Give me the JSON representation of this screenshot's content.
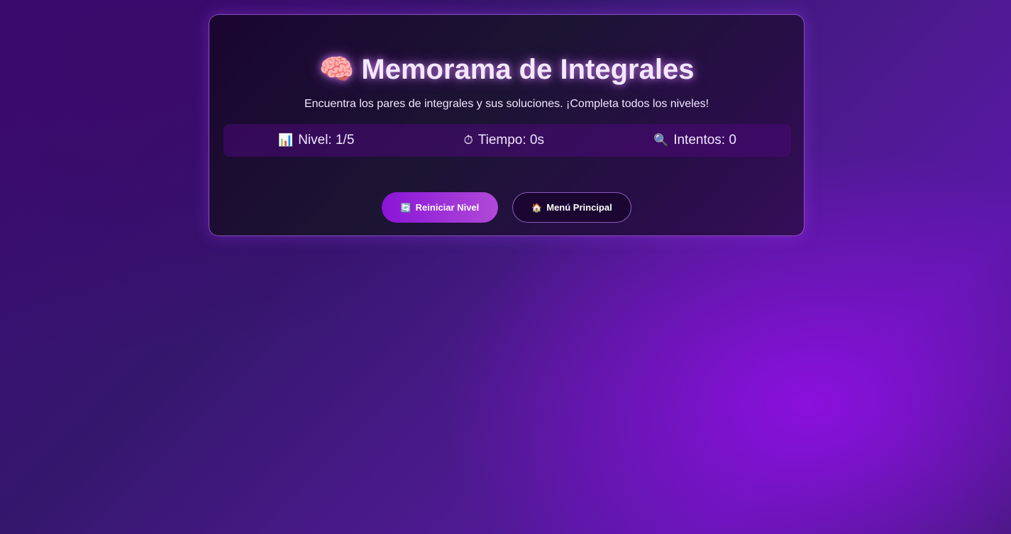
{
  "header": {
    "title_icon": "🧠",
    "title": "Memorama de Integrales",
    "subtitle": "Encuentra los pares de integrales y sus soluciones. ¡Completa todos los niveles!"
  },
  "stats": {
    "level_icon": "📊",
    "level_label": "Nivel: 1/5",
    "time_icon": "⏱",
    "time_label": "Tiempo: 0s",
    "attempts_icon": "🔍",
    "attempts_label": "Intentos: 0"
  },
  "actions": {
    "restart_icon": "🔄",
    "restart_label": "Reiniciar Nivel",
    "menu_icon": "🏠",
    "menu_label": "Menú Principal"
  },
  "colors": {
    "accent": "#8a14d8",
    "accent_light": "#b04ad8",
    "card_border": "#be6eff",
    "text": "#f1e6ff"
  }
}
